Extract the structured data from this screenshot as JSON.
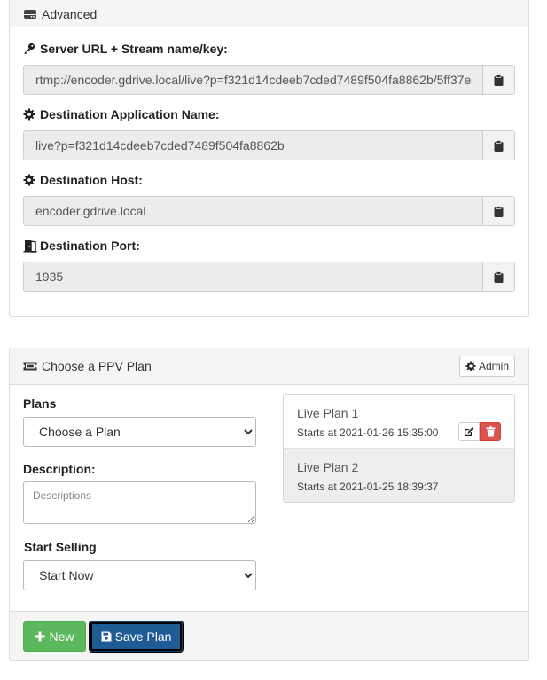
{
  "advanced": {
    "title": "Advanced",
    "fields": [
      {
        "label": "Server URL + Stream name/key:",
        "value": "rtmp://encoder.gdrive.local/live?p=f321d14cdeeb7cded7489f504fa8862b/5ff37e"
      },
      {
        "label": "Destination Application Name:",
        "value": "live?p=f321d14cdeeb7cded7489f504fa8862b"
      },
      {
        "label": "Destination Host:",
        "value": "encoder.gdrive.local"
      },
      {
        "label": "Destination Port:",
        "value": "1935"
      }
    ]
  },
  "ppv": {
    "title": "Choose a PPV Plan",
    "admin_label": "Admin",
    "plans_label": "Plans",
    "plans_select": "Choose a Plan",
    "description_label": "Description:",
    "description_placeholder": "Descriptions",
    "start_selling_label": "Start Selling",
    "start_selling_select": "Start Now",
    "plan_list": [
      {
        "name": "Live Plan 1",
        "date": "Starts at 2021-01-26 15:35:00"
      },
      {
        "name": "Live Plan 2",
        "date": "Starts at 2021-01-25 18:39:37"
      }
    ],
    "new_label": "New",
    "save_label": "Save Plan"
  },
  "colors": {
    "success": "#5cb85c",
    "primary": "#1f5b94",
    "danger": "#d9534f"
  }
}
